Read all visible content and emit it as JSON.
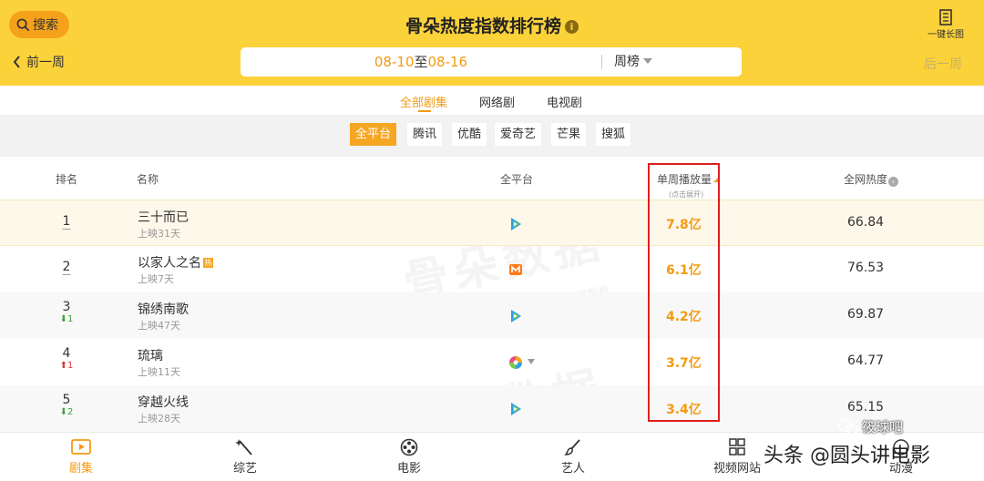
{
  "header": {
    "search_label": "搜索",
    "title": "骨朵热度指数排行榜",
    "info_icon": "i",
    "long_image_label": "一键长图",
    "prev_week": "前一周",
    "next_week": "后一周",
    "date_start": "08-10",
    "date_to": "至",
    "date_end": "08-16",
    "week_type": "周榜"
  },
  "category_tabs": [
    "全部剧集",
    "网络剧",
    "电视剧"
  ],
  "platforms": [
    "全平台",
    "腾讯",
    "优酷",
    "爱奇艺",
    "芒果",
    "搜狐"
  ],
  "table": {
    "headers": {
      "rank": "排名",
      "name": "名称",
      "platform": "全平台",
      "plays": "单周播放量",
      "plays_sub": "(点击展开)",
      "heat": "全网热度"
    },
    "rows": [
      {
        "rank": "1",
        "change": "",
        "change_dir": "",
        "name": "三十而已",
        "new": "",
        "sub": "上映31天",
        "platform_icon": "tencent-video-icon",
        "plays": "7.8亿",
        "heat": "66.84"
      },
      {
        "rank": "2",
        "change": "",
        "change_dir": "",
        "name": "以家人之名",
        "new": "热",
        "sub": "上映7天",
        "platform_icon": "mango-tv-icon",
        "plays": "6.1亿",
        "heat": "76.53"
      },
      {
        "rank": "3",
        "change": "1",
        "change_dir": "down",
        "name": "锦绣南歌",
        "new": "",
        "sub": "上映47天",
        "platform_icon": "tencent-video-icon",
        "plays": "4.2亿",
        "heat": "69.87"
      },
      {
        "rank": "4",
        "change": "1",
        "change_dir": "up",
        "name": "琉璃",
        "new": "",
        "sub": "上映11天",
        "platform_icon": "multi-platform-icon",
        "plays": "3.7亿",
        "heat": "64.77"
      },
      {
        "rank": "5",
        "change": "2",
        "change_dir": "down",
        "name": "穿越火线",
        "new": "",
        "sub": "上映28天",
        "platform_icon": "tencent-video-icon",
        "plays": "3.4亿",
        "heat": "65.15"
      }
    ]
  },
  "watermark": {
    "text": "骨朵数据",
    "sub": "@骨朵网络影视"
  },
  "bottom_nav": [
    "剧集",
    "综艺",
    "电影",
    "艺人",
    "视频网站",
    "动漫"
  ],
  "overlay": {
    "source": "头条 @圆头讲电影",
    "wechat": "筱球吧"
  },
  "colors": {
    "header_bg": "#fcd23a",
    "accent": "#f29b12",
    "highlight": "#e01e1e"
  }
}
